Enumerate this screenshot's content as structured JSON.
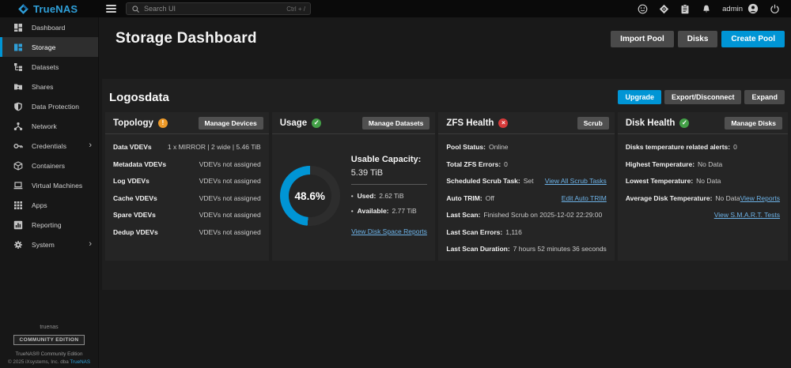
{
  "topbar": {
    "logo_text": "TrueNAS",
    "search": {
      "placeholder": "Search UI",
      "shortcut": "Ctrl + /"
    },
    "username": "admin"
  },
  "sidebar": {
    "items": [
      {
        "label": "Dashboard"
      },
      {
        "label": "Storage"
      },
      {
        "label": "Datasets"
      },
      {
        "label": "Shares"
      },
      {
        "label": "Data Protection"
      },
      {
        "label": "Network"
      },
      {
        "label": "Credentials"
      },
      {
        "label": "Containers"
      },
      {
        "label": "Virtual Machines"
      },
      {
        "label": "Apps"
      },
      {
        "label": "Reporting"
      },
      {
        "label": "System"
      }
    ],
    "footer": {
      "hostname": "truenas",
      "badge": "COMMUNITY EDITION",
      "edition": "TrueNAS® Community Edition",
      "copyright_prefix": "© 2025 iXsystems, Inc. dba ",
      "copyright_link": "TrueNAS"
    }
  },
  "header": {
    "title": "Storage Dashboard",
    "import_pool": "Import Pool",
    "disks": "Disks",
    "create_pool": "Create Pool"
  },
  "pool": {
    "name": "Logosdata",
    "upgrade": "Upgrade",
    "export_disconnect": "Export/Disconnect",
    "expand": "Expand",
    "cards": {
      "topology": {
        "title": "Topology",
        "status_icon": "warning-icon",
        "button": "Manage Devices",
        "rows": [
          {
            "label": "Data VDEVs",
            "value": "1 x MIRROR | 2 wide | 5.46 TiB"
          },
          {
            "label": "Metadata VDEVs",
            "value": "VDEVs not assigned"
          },
          {
            "label": "Log VDEVs",
            "value": "VDEVs not assigned"
          },
          {
            "label": "Cache VDEVs",
            "value": "VDEVs not assigned"
          },
          {
            "label": "Spare VDEVs",
            "value": "VDEVs not assigned"
          },
          {
            "label": "Dedup VDEVs",
            "value": "VDEVs not assigned"
          }
        ]
      },
      "usage": {
        "title": "Usage",
        "status_icon": "check-icon",
        "button": "Manage Datasets",
        "percent": "48.6%",
        "usable_capacity_label": "Usable Capacity:",
        "usable_capacity_value": "5.39 TiB",
        "used_label": "Used:",
        "used_value": "2.62 TiB",
        "available_label": "Available:",
        "available_value": "2.77 TiB",
        "link": "View Disk Space Reports"
      },
      "zfs_health": {
        "title": "ZFS Health",
        "status_icon": "error-icon",
        "button": "Scrub",
        "rows": [
          {
            "label": "Pool Status:",
            "value": "Online",
            "link": ""
          },
          {
            "label": "Total ZFS Errors:",
            "value": "0",
            "link": ""
          },
          {
            "label": "Scheduled Scrub Task:",
            "value": "Set",
            "link": "View All Scrub Tasks"
          },
          {
            "label": "Auto TRIM:",
            "value": "Off",
            "link": "Edit Auto TRIM"
          },
          {
            "label": "Last Scan:",
            "value": "Finished Scrub on 2025-12-02 22:29:00",
            "link": ""
          },
          {
            "label": "Last Scan Errors:",
            "value": "1,116",
            "link": ""
          },
          {
            "label": "Last Scan Duration:",
            "value": "7 hours 52 minutes 36 seconds",
            "link": ""
          }
        ]
      },
      "disk_health": {
        "title": "Disk Health",
        "status_icon": "check-icon",
        "button": "Manage Disks",
        "rows": [
          {
            "label": "Disks temperature related alerts:",
            "value": "0",
            "link": ""
          },
          {
            "label": "Highest Temperature:",
            "value": "No Data",
            "link": ""
          },
          {
            "label": "Lowest Temperature:",
            "value": "No Data",
            "link": ""
          },
          {
            "label": "Average Disk Temperature:",
            "value": "No Data",
            "link": "View Reports"
          }
        ],
        "smart_link": "View S.M.A.R.T. Tests"
      }
    }
  }
}
